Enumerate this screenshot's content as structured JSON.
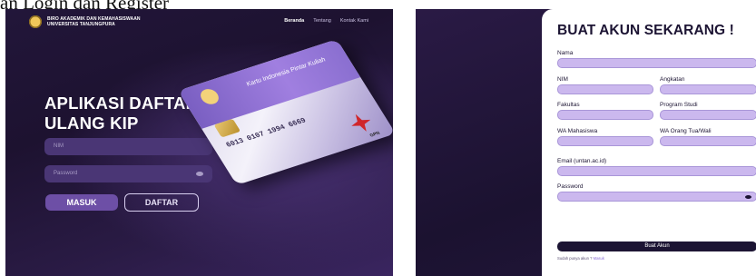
{
  "caption": "an Login dan Register",
  "login": {
    "brand_line1": "BIRO AKADEMIK DAN KEMAHASISWAAN",
    "brand_line2": "UNIVERSITAS TANJUNGPURA",
    "nav": [
      "Beranda",
      "Tentang",
      "Kontak Kami"
    ],
    "title_line1": "APLIKASI DAFTAR",
    "title_line2": "ULANG KIP",
    "nim_placeholder": "NIM",
    "password_placeholder": "Password",
    "login_button": "MASUK",
    "register_button": "DAFTAR",
    "card": {
      "label": "Kartu Indonesia Pintar Kuliah",
      "number": "6013 0107 1994 6669",
      "network": "GPN"
    }
  },
  "register": {
    "title": "BUAT AKUN SEKARANG !",
    "labels": {
      "nama": "Nama",
      "nim": "NIM",
      "angkatan": "Angkatan",
      "fakultas": "Fakultas",
      "prodi": "Program Studi",
      "wa_mhs": "WA Mahasiswa",
      "wa_ortu": "WA Orang Tua/Wali",
      "email": "Email (untan.ac.id)",
      "password": "Password"
    },
    "submit": "Buat Akun",
    "footer_text": "Sudah punya akun ?",
    "footer_link": "Masuk"
  }
}
